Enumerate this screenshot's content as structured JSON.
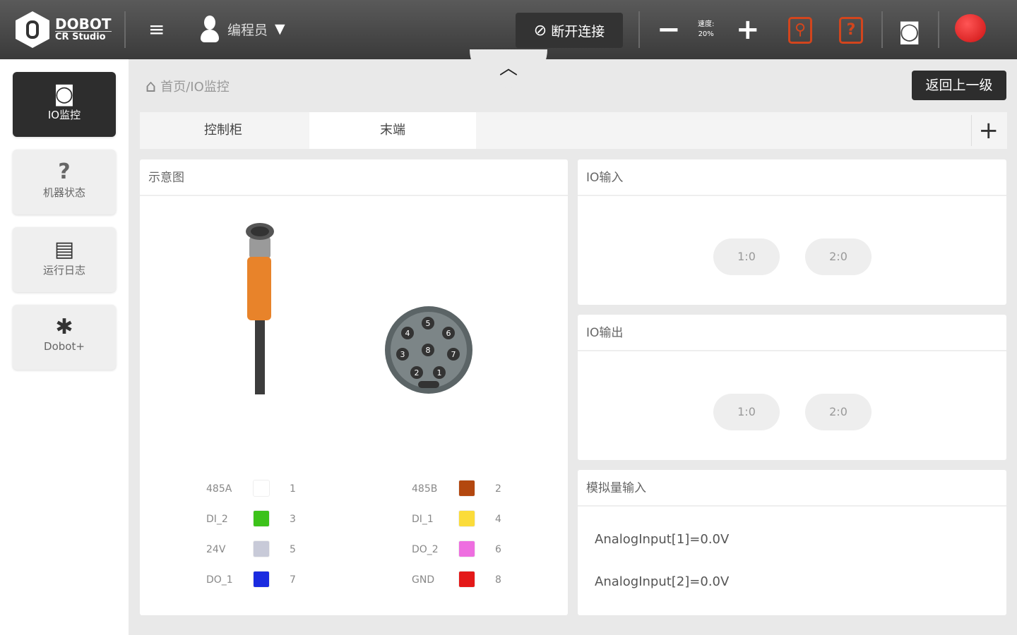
{
  "header": {
    "logo_title": "DOBOT",
    "logo_subtitle": "CR Studio",
    "user_role": "编程员",
    "disconnect_label": "断开连接",
    "speed_label": "速度:",
    "speed_value": "20%"
  },
  "sidebar": {
    "items": [
      {
        "label": "IO监控",
        "icon": "io-monitor-icon"
      },
      {
        "label": "机器状态",
        "icon": "question-icon"
      },
      {
        "label": "运行日志",
        "icon": "log-icon"
      },
      {
        "label": "Dobot+",
        "icon": "puzzle-icon"
      }
    ]
  },
  "breadcrumb": "首页/IO监控",
  "back_label": "返回上一级",
  "tabs": [
    {
      "label": "控制柜"
    },
    {
      "label": "末端"
    }
  ],
  "diagram": {
    "title": "示意图",
    "pins_left": [
      {
        "name": "485A",
        "color": "#ffffff",
        "pin": "1"
      },
      {
        "name": "DI_2",
        "color": "#3cc21a",
        "pin": "3"
      },
      {
        "name": "24V",
        "color": "#c8cad8",
        "pin": "5"
      },
      {
        "name": "DO_1",
        "color": "#1a2be0",
        "pin": "7"
      }
    ],
    "pins_right": [
      {
        "name": "485B",
        "color": "#b3470f",
        "pin": "2"
      },
      {
        "name": "DI_1",
        "color": "#fbdc3a",
        "pin": "4"
      },
      {
        "name": "DO_2",
        "color": "#ee6ee0",
        "pin": "6"
      },
      {
        "name": "GND",
        "color": "#e41818",
        "pin": "8"
      }
    ]
  },
  "io_input": {
    "title": "IO输入",
    "buttons": [
      "1:0",
      "2:0"
    ]
  },
  "io_output": {
    "title": "IO输出",
    "buttons": [
      "1:0",
      "2:0"
    ]
  },
  "analog": {
    "title": "模拟量输入",
    "values": [
      "AnalogInput[1]=0.0V",
      "AnalogInput[2]=0.0V"
    ]
  }
}
